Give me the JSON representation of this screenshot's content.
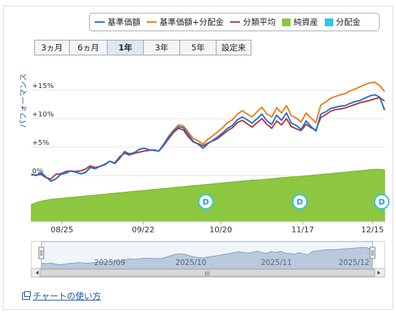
{
  "legend": [
    {
      "label": "基準価額",
      "color": "#1f6fd1",
      "kind": "line"
    },
    {
      "label": "基準価額+分配金",
      "color": "#f07a1a",
      "kind": "line"
    },
    {
      "label": "分類平均",
      "color": "#b03a3a",
      "kind": "line"
    },
    {
      "label": "純資産",
      "color": "#8dc63f",
      "kind": "box"
    },
    {
      "label": "分配金",
      "color": "#2cc6e6",
      "kind": "box"
    }
  ],
  "tabs": [
    {
      "label": "3ヵ月",
      "active": false
    },
    {
      "label": "6ヵ月",
      "active": false
    },
    {
      "label": "1年",
      "active": true
    },
    {
      "label": "3年",
      "active": false
    },
    {
      "label": "5年",
      "active": false
    },
    {
      "label": "設定来",
      "active": false
    }
  ],
  "y_axis_label": "パフォーマンス",
  "y_ticks": [
    "+15%",
    "+10%",
    "+5%",
    "0%"
  ],
  "x_ticks": [
    "08/25",
    "09/22",
    "10/20",
    "11/17",
    "12/15"
  ],
  "dividend_markers": [
    "D",
    "D",
    "D"
  ],
  "navigator": {
    "labels": [
      "2025/09",
      "2025/10",
      "2025/11",
      "2025/12"
    ],
    "scroll_grip": "III"
  },
  "howto_link": "チャートの使い方",
  "chart_data": {
    "type": "line",
    "ylim": [
      -4,
      17
    ],
    "y_ticks": [
      15,
      10,
      5,
      0
    ],
    "series": [
      {
        "name": "基準価額",
        "color": "#1f6fd1",
        "values": [
          0.2,
          0.0,
          0.5,
          -0.3,
          -1.0,
          -0.6,
          0.2,
          0.4,
          0.8,
          0.6,
          0.3,
          0.5,
          1.4,
          1.2,
          1.6,
          1.9,
          2.5,
          2.1,
          3.0,
          4.2,
          3.8,
          4.0,
          4.6,
          4.8,
          4.5,
          4.4,
          4.3,
          5.5,
          6.8,
          7.8,
          8.6,
          8.4,
          7.2,
          6.0,
          5.5,
          4.8,
          5.6,
          6.2,
          6.8,
          7.5,
          8.3,
          8.8,
          9.8,
          10.3,
          9.8,
          9.2,
          10.0,
          10.8,
          9.6,
          9.0,
          10.6,
          9.7,
          11.0,
          9.2,
          8.8,
          8.1,
          9.6,
          8.6,
          7.8,
          10.8,
          11.2,
          11.8,
          12.0,
          12.2,
          12.3,
          12.7,
          13.0,
          13.2,
          13.6,
          14.0,
          14.2,
          13.8,
          11.5
        ]
      },
      {
        "name": "基準価額+分配金",
        "color": "#f07a1a",
        "values": [
          0.2,
          0.0,
          0.5,
          -0.3,
          -1.0,
          -0.6,
          0.2,
          0.4,
          0.8,
          0.6,
          0.3,
          0.5,
          1.4,
          1.2,
          1.6,
          1.9,
          2.5,
          2.1,
          3.0,
          4.2,
          3.8,
          4.0,
          4.6,
          4.8,
          4.5,
          4.4,
          4.3,
          5.5,
          6.9,
          8.0,
          8.9,
          8.7,
          7.6,
          6.5,
          6.1,
          5.5,
          6.4,
          7.0,
          7.7,
          8.4,
          9.3,
          9.8,
          10.8,
          11.4,
          10.8,
          10.3,
          11.2,
          12.0,
          10.8,
          10.3,
          11.9,
          11.0,
          12.3,
          10.5,
          10.1,
          9.4,
          11.0,
          10.1,
          9.3,
          12.4,
          12.9,
          13.6,
          13.9,
          14.2,
          14.4,
          14.9,
          15.2,
          15.6,
          16.0,
          16.3,
          16.4,
          15.8,
          14.8
        ]
      },
      {
        "name": "分類平均",
        "color": "#b03a3a",
        "values": [
          0.1,
          0.1,
          0.2,
          -0.4,
          -0.6,
          0.2,
          0.3,
          0.7,
          0.8,
          0.7,
          0.8,
          1.1,
          1.7,
          1.4,
          1.6,
          2.0,
          2.5,
          2.2,
          3.3,
          3.9,
          3.6,
          3.9,
          4.1,
          4.3,
          4.4,
          4.5,
          4.3,
          5.3,
          6.5,
          7.6,
          8.3,
          8.0,
          6.8,
          5.9,
          5.6,
          5.2,
          5.7,
          6.1,
          6.5,
          7.2,
          7.9,
          8.4,
          9.3,
          9.7,
          9.1,
          8.5,
          9.3,
          10.0,
          9.0,
          8.3,
          9.6,
          8.9,
          10.0,
          8.6,
          8.2,
          7.9,
          9.0,
          8.4,
          8.0,
          10.2,
          10.7,
          11.3,
          11.6,
          11.7,
          11.9,
          12.2,
          12.5,
          12.8,
          13.0,
          13.2,
          13.5,
          13.7,
          13.1
        ]
      },
      {
        "name": "純資産",
        "color": "#8dc63f",
        "values": [
          14,
          18,
          21,
          23,
          25,
          26,
          27,
          28,
          29,
          30,
          31,
          32,
          33,
          34,
          35,
          36,
          37,
          38,
          39,
          40,
          41,
          42,
          43,
          44,
          45,
          46,
          47,
          48,
          49,
          50,
          51,
          52,
          53,
          54,
          55,
          56,
          57,
          58,
          59,
          60,
          61,
          62,
          63,
          64,
          65,
          66,
          66,
          67,
          68,
          69,
          70,
          71,
          72,
          73,
          73,
          74,
          75,
          76,
          77,
          78,
          79,
          80,
          81,
          82,
          83,
          84,
          85,
          86,
          87,
          88,
          89,
          89,
          88
        ]
      }
    ]
  }
}
